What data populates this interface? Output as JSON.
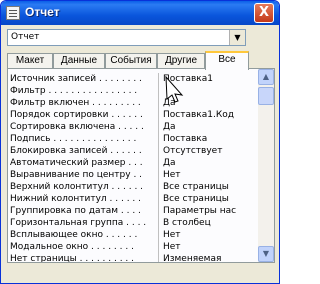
{
  "window": {
    "title": "Отчет",
    "close_label": "X"
  },
  "selector": {
    "value": "Отчет",
    "arrow": "▼"
  },
  "tabs": [
    {
      "label": "Макет"
    },
    {
      "label": "Данные"
    },
    {
      "label": "События"
    },
    {
      "label": "Другие"
    },
    {
      "label": "Все"
    }
  ],
  "properties": [
    {
      "name": "Источник записей . . . . . . . .",
      "value": "Поставка1"
    },
    {
      "name": "Фильтр . . . . . . . . . . . . . . . .",
      "value": ""
    },
    {
      "name": "Фильтр включен . . . . . . . . .",
      "value": "Да"
    },
    {
      "name": "Порядок сортировки . . . . . .",
      "value": "Поставка1.Код"
    },
    {
      "name": "Сортировка включена . . . . .",
      "value": "Да"
    },
    {
      "name": "Подпись . . . . . . . . . . . . . . .",
      "value": "Поставка"
    },
    {
      "name": "Блокировка записей . . . . . .",
      "value": "Отсутствует"
    },
    {
      "name": "Автоматический размер . . .",
      "value": "Да"
    },
    {
      "name": "Выравнивание по центру . .",
      "value": "Нет"
    },
    {
      "name": "Верхний колонтитул . . . . . .",
      "value": "Все страницы"
    },
    {
      "name": "Нижний колонтитул . . . . . .",
      "value": "Все страницы"
    },
    {
      "name": "Группировка по датам . . . .",
      "value": "Параметры нас"
    },
    {
      "name": "Горизонтальная группа . . . .",
      "value": "В столбец"
    },
    {
      "name": "Всплывающее окно . . . . . .",
      "value": "Нет"
    },
    {
      "name": "Модальное окно . . . . . . . .",
      "value": "Нет"
    },
    {
      "name": "Нет страницы . . . . . . . . . .",
      "value": "Изменяемая"
    }
  ],
  "scrollbar": {
    "up_arrow": "▲",
    "down_arrow": "▼"
  }
}
